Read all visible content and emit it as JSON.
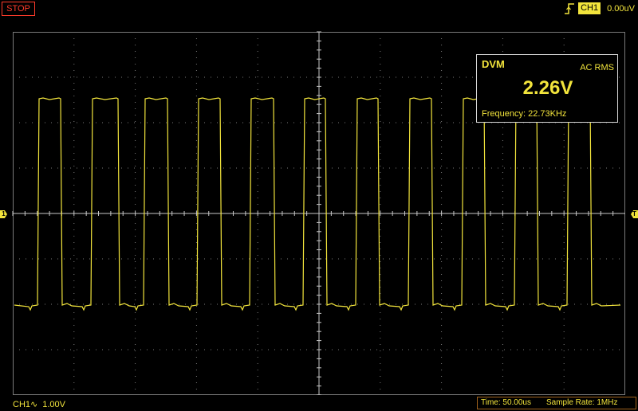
{
  "status": {
    "run_state": "STOP"
  },
  "trigger": {
    "channel": "CH1",
    "level": "0.00uV",
    "edge_icon": "rising-edge-icon"
  },
  "dvm": {
    "title": "DVM",
    "mode": "AC RMS",
    "value": "2.26V",
    "frequency": "Frequency: 22.73KHz"
  },
  "channel": {
    "label": "CH1",
    "coupling_icon": "ac-coupling-icon",
    "coupling_glyph": "∿",
    "volts_per_div": "1.00V"
  },
  "timebase": {
    "time_per_div": "Time: 50.00us",
    "sample_rate": "Sample Rate: 1MHz"
  },
  "markers": {
    "channel_level": "1",
    "trigger_level": "T"
  },
  "colors": {
    "trace": "#f2e43c",
    "grid": "#7a7a7a",
    "stop": "#ff3b2b",
    "background": "#000000"
  }
}
